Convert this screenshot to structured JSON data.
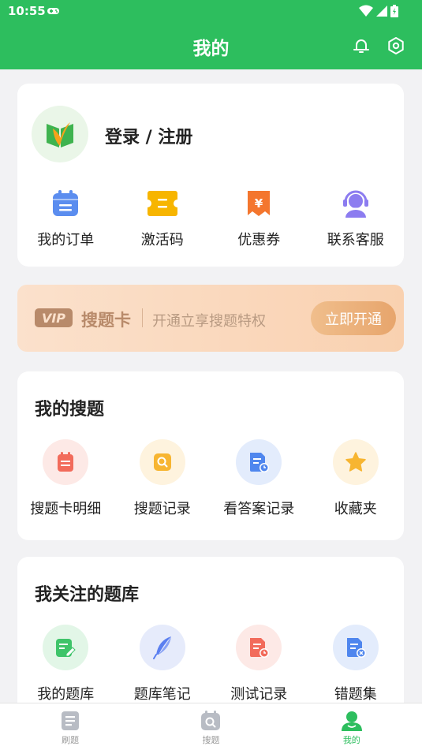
{
  "status_bar": {
    "time": "10:55"
  },
  "header": {
    "title": "我的"
  },
  "profile": {
    "login_label": "登录 / 注册"
  },
  "quick_actions": [
    {
      "label": "我的订单",
      "icon": "calendar-order-icon",
      "color": "#5b8def"
    },
    {
      "label": "激活码",
      "icon": "ticket-icon",
      "color": "#f7b500"
    },
    {
      "label": "优惠券",
      "icon": "coupon-icon",
      "color": "#f4762e"
    },
    {
      "label": "联系客服",
      "icon": "customer-service-icon",
      "color": "#8c7cf0"
    }
  ],
  "vip_banner": {
    "badge": "VIP",
    "name": "搜题卡",
    "description": "开通立享搜题特权",
    "button": "立即开通"
  },
  "my_search": {
    "title": "我的搜题",
    "items": [
      {
        "label": "搜题卡明细",
        "icon": "card-detail-icon",
        "color": "#f26b5b",
        "bg": "#fde9e6"
      },
      {
        "label": "搜题记录",
        "icon": "search-record-icon",
        "color": "#f7b531",
        "bg": "#fef3de"
      },
      {
        "label": "看答案记录",
        "icon": "answer-record-icon",
        "color": "#4f86ee",
        "bg": "#e3ecfc"
      },
      {
        "label": "收藏夹",
        "icon": "star-icon",
        "color": "#f7b531",
        "bg": "#fef3de"
      }
    ]
  },
  "my_banks": {
    "title": "我关注的题库",
    "items": [
      {
        "label": "我的题库",
        "icon": "edit-bank-icon",
        "color": "#3fc46a",
        "bg": "#e2f6e7"
      },
      {
        "label": "题库笔记",
        "icon": "feather-icon",
        "color": "#5b7ff0",
        "bg": "#e6ebfb"
      },
      {
        "label": "测试记录",
        "icon": "test-record-icon",
        "color": "#f26b5b",
        "bg": "#fde9e6"
      },
      {
        "label": "错题集",
        "icon": "wrong-set-icon",
        "color": "#4f86ee",
        "bg": "#e3ecfc"
      }
    ]
  },
  "tabbar": [
    {
      "label": "刷题",
      "icon": "practice-icon",
      "active": false
    },
    {
      "label": "搜题",
      "icon": "search-tab-icon",
      "active": false
    },
    {
      "label": "我的",
      "icon": "profile-icon",
      "active": true
    }
  ],
  "colors": {
    "brand": "#2dbe5e",
    "background": "#f2f2f4"
  }
}
